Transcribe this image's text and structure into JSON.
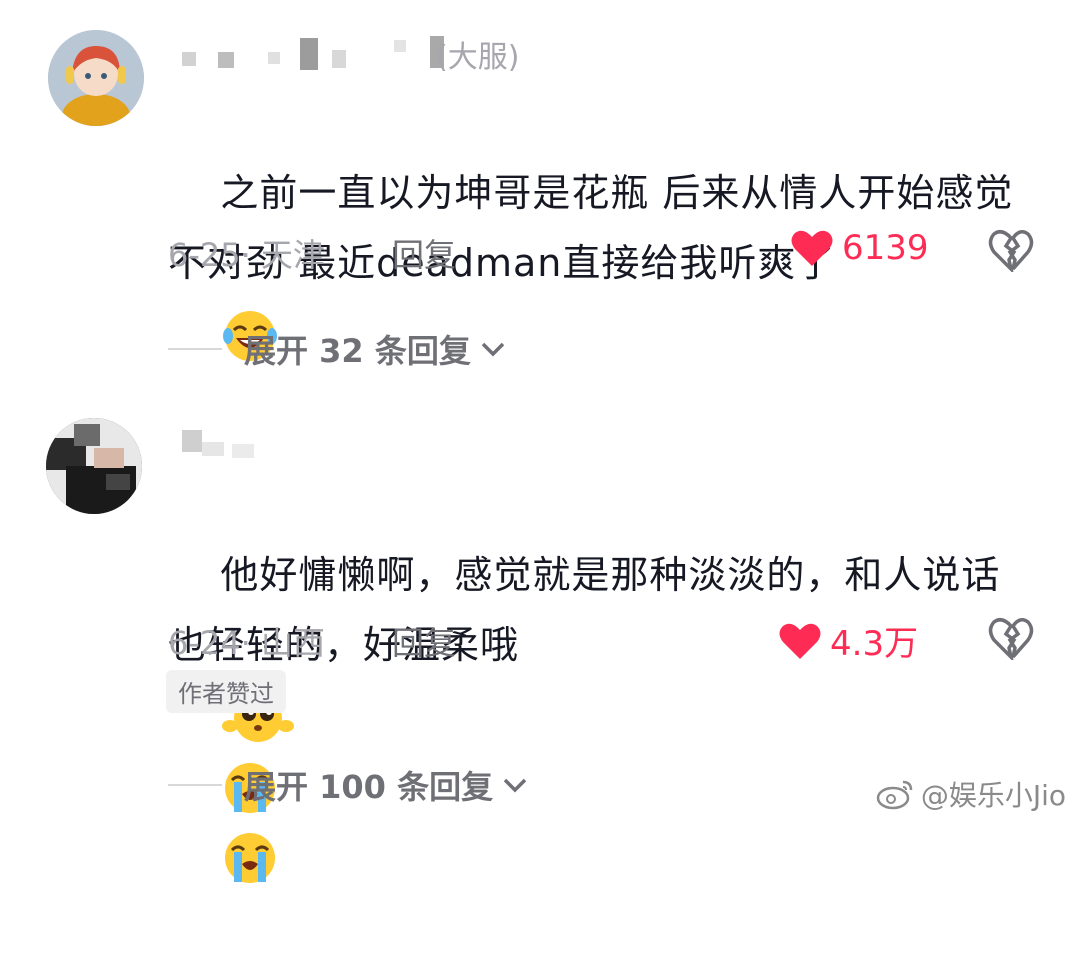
{
  "comments": [
    {
      "username_suffix": "(大服)",
      "text": "之前一直以为坤哥是花瓶 后来从情人开始感觉不对劲 最近deadman直接给我听爽了",
      "meta": "6-25· 天津",
      "reply_label": "回复",
      "likes": "6139",
      "expand_label": "展开 32 条回复",
      "emojis": [
        "laughing-crying-face"
      ]
    },
    {
      "text": "他好慵懒啊，感觉就是那种淡淡的，和人说话也轻轻的，好温柔哦",
      "meta": "6-24· 山西",
      "reply_label": "回复",
      "likes": "4.3万",
      "author_badge": "作者赞过",
      "expand_label": "展开 100 条回复",
      "emojis": [
        "pleading-face",
        "loudly-crying-face",
        "loudly-crying-face"
      ]
    }
  ],
  "watermark": {
    "text": "@娱乐小Jio",
    "icon": "weibo-logo"
  },
  "colors": {
    "like": "#fe2c55",
    "meta": "#a6a6ad",
    "text": "#161823"
  }
}
